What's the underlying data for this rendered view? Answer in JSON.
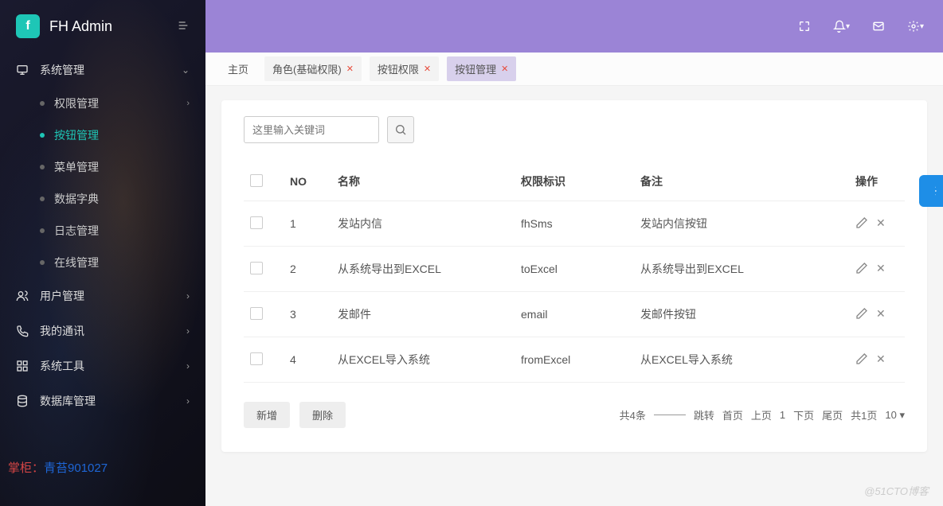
{
  "app": {
    "name": "FH Admin",
    "logo_letter": "f"
  },
  "sidebar": {
    "groups": [
      {
        "icon": "monitor",
        "label": "系统管理",
        "expanded": true,
        "items": [
          {
            "label": "权限管理",
            "has_children": true
          },
          {
            "label": "按钮管理",
            "active": true
          },
          {
            "label": "菜单管理"
          },
          {
            "label": "数据字典"
          },
          {
            "label": "日志管理"
          },
          {
            "label": "在线管理"
          }
        ]
      },
      {
        "icon": "users",
        "label": "用户管理"
      },
      {
        "icon": "phone",
        "label": "我的通讯"
      },
      {
        "icon": "grid",
        "label": "系统工具"
      },
      {
        "icon": "database",
        "label": "数据库管理"
      }
    ],
    "footer": {
      "key": "掌柜：",
      "value": "青苔901027"
    }
  },
  "tabs": [
    {
      "label": "主页",
      "home": true
    },
    {
      "label": "角色(基础权限)",
      "closable": true
    },
    {
      "label": "按钮权限",
      "closable": true
    },
    {
      "label": "按钮管理",
      "closable": true,
      "active": true
    }
  ],
  "search": {
    "placeholder": "这里输入关键词"
  },
  "table": {
    "headers": {
      "no": "NO",
      "name": "名称",
      "perm": "权限标识",
      "remark": "备注",
      "ops": "操作"
    },
    "rows": [
      {
        "no": "1",
        "name": "发站内信",
        "perm": "fhSms",
        "remark": "发站内信按钮"
      },
      {
        "no": "2",
        "name": "从系统导出到EXCEL",
        "perm": "toExcel",
        "remark": "从系统导出到EXCEL"
      },
      {
        "no": "3",
        "name": "发邮件",
        "perm": "email",
        "remark": "发邮件按钮"
      },
      {
        "no": "4",
        "name": "从EXCEL导入系统",
        "perm": "fromExcel",
        "remark": "从EXCEL导入系统"
      }
    ]
  },
  "actions": {
    "add": "新增",
    "delete": "删除"
  },
  "pager": {
    "total": "共4条",
    "jump": "跳转",
    "first": "首页",
    "prev": "上页",
    "current": "1",
    "next": "下页",
    "last": "尾页",
    "pages": "共1页",
    "size": "10"
  },
  "watermark": "@51CTO博客"
}
